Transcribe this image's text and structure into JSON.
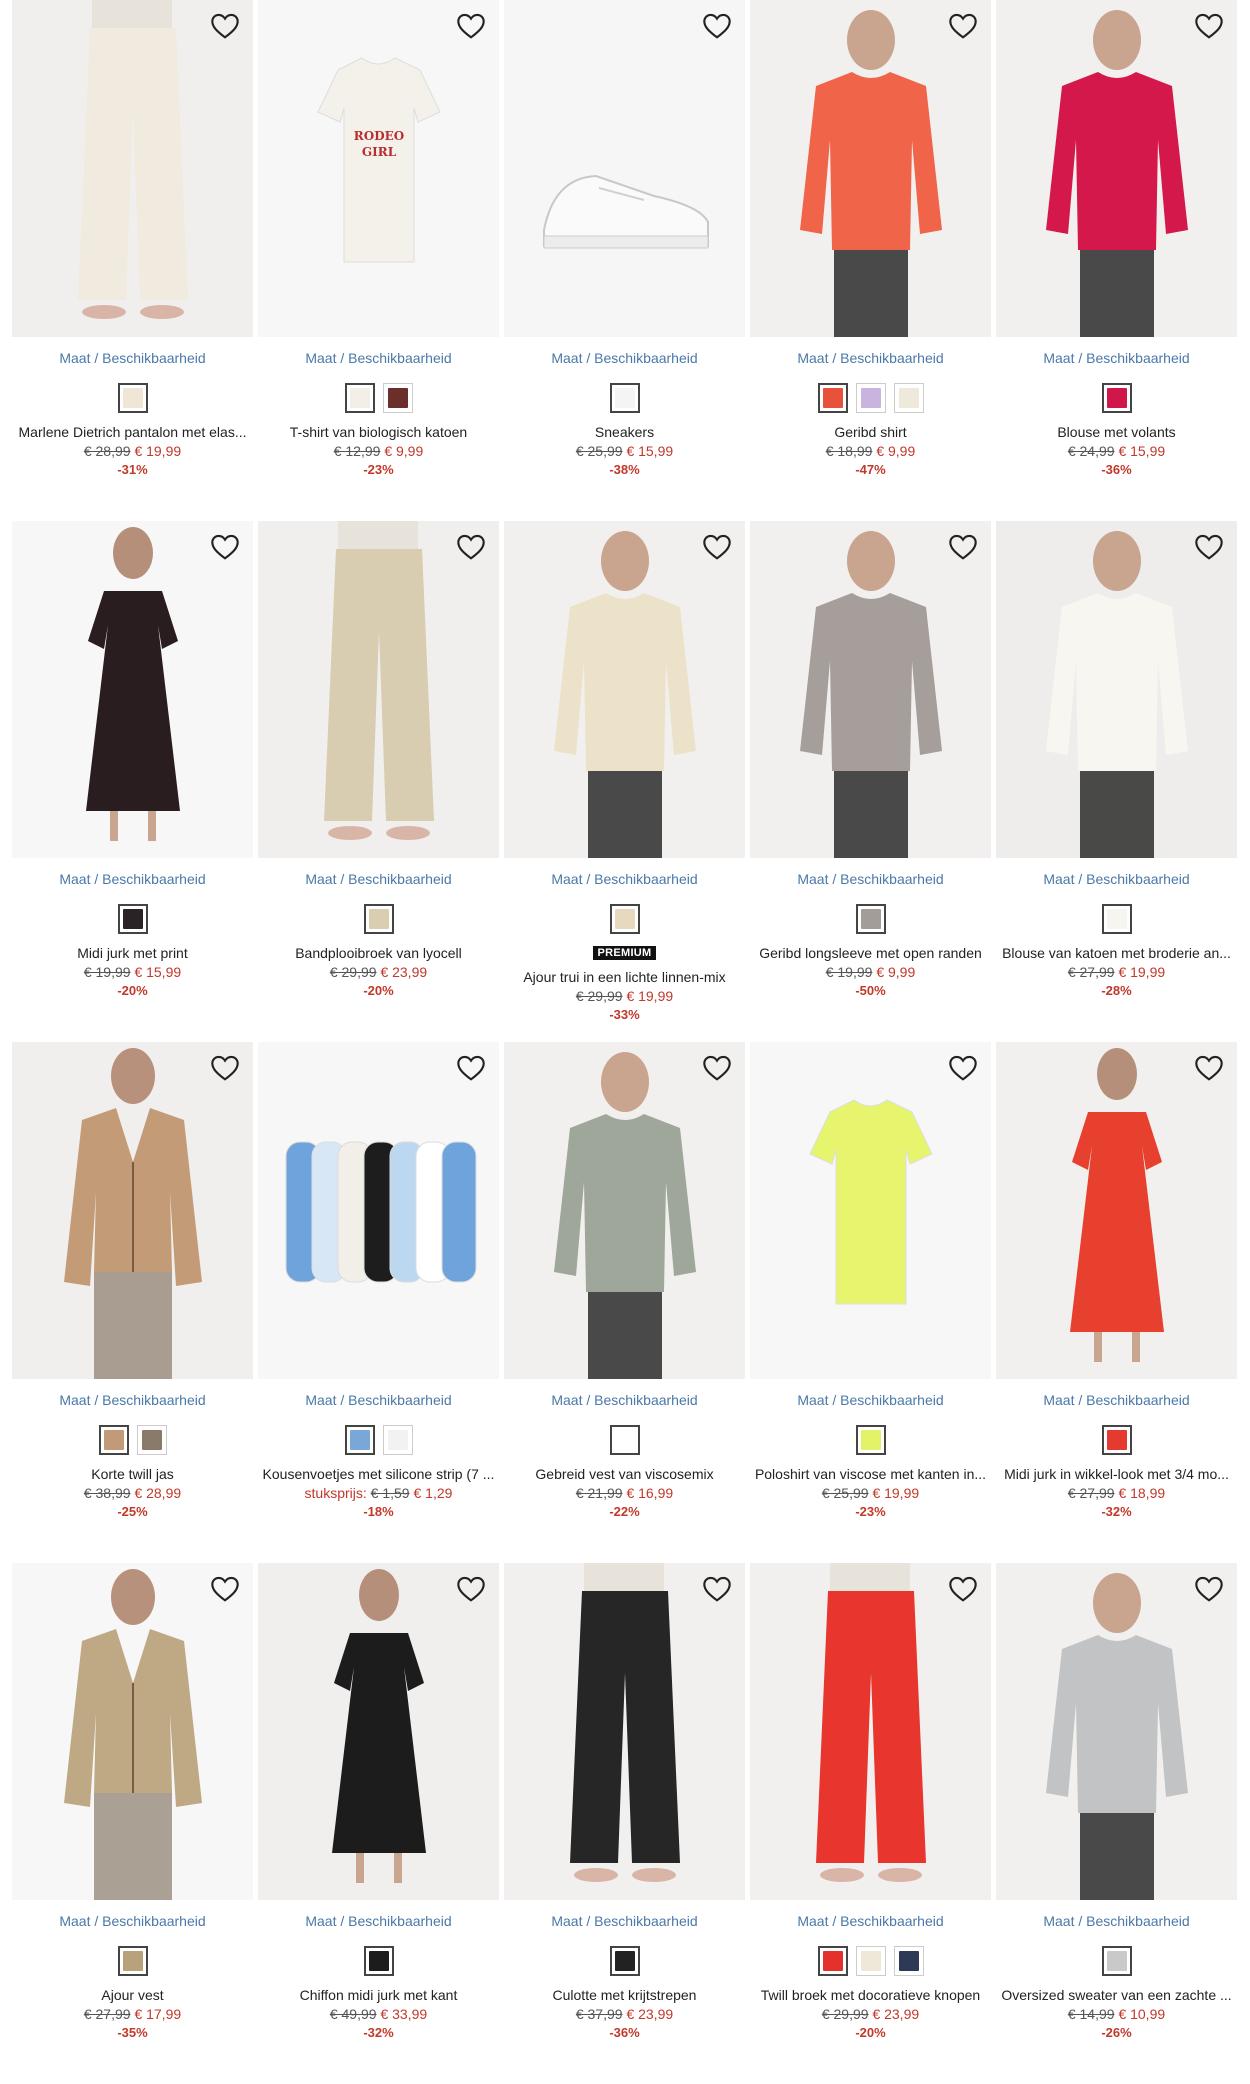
{
  "products": [
    {
      "name": "Marlene Dietrich pantalon met elas...",
      "size_link": "Maat / Beschikbaarheid",
      "old_price": "€ 28,99",
      "new_price": "€ 19,99",
      "discount": "-31%",
      "badge": null,
      "unit_label": null,
      "swatches": [
        "#efe6d6"
      ],
      "figure": {
        "type": "pants",
        "color": "#f1ebdf",
        "bg": "#f0efed"
      }
    },
    {
      "name": "T-shirt van biologisch katoen",
      "size_link": "Maat / Beschikbaarheid",
      "old_price": "€ 12,99",
      "new_price": "€ 9,99",
      "discount": "-23%",
      "badge": null,
      "unit_label": null,
      "swatches": [
        "#f3efe6",
        "#6b2e2a"
      ],
      "figure": {
        "type": "tshirt",
        "color": "#f4f1ea",
        "bg": "#f7f7f7",
        "text": "RODEO GIRL"
      }
    },
    {
      "name": "Sneakers",
      "size_link": "Maat / Beschikbaarheid",
      "old_price": "€ 25,99",
      "new_price": "€ 15,99",
      "discount": "-38%",
      "badge": null,
      "unit_label": null,
      "swatches": [
        "#f4f4f4"
      ],
      "figure": {
        "type": "shoe",
        "color": "#fafafa",
        "bg": "#f6f6f6"
      }
    },
    {
      "name": "Geribd shirt",
      "size_link": "Maat / Beschikbaarheid",
      "old_price": "€ 18,99",
      "new_price": "€ 9,99",
      "discount": "-47%",
      "badge": null,
      "unit_label": null,
      "swatches": [
        "#e8523a",
        "#c9b4e0",
        "#efe9dc"
      ],
      "figure": {
        "type": "top",
        "color": "#f0644a",
        "bg": "#f1f0ee"
      }
    },
    {
      "name": "Blouse met volants",
      "size_link": "Maat / Beschikbaarheid",
      "old_price": "€ 24,99",
      "new_price": "€ 15,99",
      "discount": "-36%",
      "badge": null,
      "unit_label": null,
      "swatches": [
        "#d0174a"
      ],
      "figure": {
        "type": "top",
        "color": "#d4184c",
        "bg": "#f1f0ee"
      }
    },
    {
      "name": "Midi jurk met print",
      "size_link": "Maat / Beschikbaarheid",
      "old_price": "€ 19,99",
      "new_price": "€ 15,99",
      "discount": "-20%",
      "badge": null,
      "unit_label": null,
      "swatches": [
        "#2a2224"
      ],
      "figure": {
        "type": "dress",
        "color": "#2a1d1f",
        "bg": "#f7f7f7"
      }
    },
    {
      "name": "Bandplooibroek van lyocell",
      "size_link": "Maat / Beschikbaarheid",
      "old_price": "€ 29,99",
      "new_price": "€ 23,99",
      "discount": "-20%",
      "badge": null,
      "unit_label": null,
      "swatches": [
        "#d9ceb0"
      ],
      "figure": {
        "type": "pants",
        "color": "#d8cdb0",
        "bg": "#f0efed"
      }
    },
    {
      "name": "Ajour trui in een lichte linnen-mix",
      "size_link": "Maat / Beschikbaarheid",
      "old_price": "€ 29,99",
      "new_price": "€ 19,99",
      "discount": "-33%",
      "badge": "PREMIUM",
      "unit_label": null,
      "swatches": [
        "#e6d9bd"
      ],
      "figure": {
        "type": "top",
        "color": "#ece2c9",
        "bg": "#f1f0ee"
      }
    },
    {
      "name": "Geribd longsleeve met open randen",
      "size_link": "Maat / Beschikbaarheid",
      "old_price": "€ 19,99",
      "new_price": "€ 9,99",
      "discount": "-50%",
      "badge": null,
      "unit_label": null,
      "swatches": [
        "#a39d99"
      ],
      "figure": {
        "type": "top",
        "color": "#a59e9b",
        "bg": "#f1f0ee"
      }
    },
    {
      "name": "Blouse van katoen met broderie an...",
      "size_link": "Maat / Beschikbaarheid",
      "old_price": "€ 27,99",
      "new_price": "€ 19,99",
      "discount": "-28%",
      "badge": null,
      "unit_label": null,
      "swatches": [
        "#f7f5f0"
      ],
      "figure": {
        "type": "top",
        "color": "#f8f6f1",
        "bg": "#eeedeb"
      }
    },
    {
      "name": "Korte twill jas",
      "size_link": "Maat / Beschikbaarheid",
      "old_price": "€ 38,99",
      "new_price": "€ 28,99",
      "discount": "-25%",
      "badge": null,
      "unit_label": null,
      "swatches": [
        "#c39a77",
        "#8a7a6a"
      ],
      "figure": {
        "type": "jacket",
        "color": "#c49b77",
        "bg": "#f0efed"
      }
    },
    {
      "name": "Kousenvoetjes met silicone strip (7 ...",
      "size_link": "Maat / Beschikbaarheid",
      "old_price": "€ 1,59",
      "new_price": "€ 1,29",
      "discount": "-18%",
      "badge": null,
      "unit_label": "stuksprijs:",
      "swatches": [
        "#7aa7d9",
        "#f2f2f2"
      ],
      "figure": {
        "type": "socks",
        "color": "#6fa3dc",
        "bg": "#f7f7f7"
      }
    },
    {
      "name": "Gebreid vest van viscosemix",
      "size_link": "Maat / Beschikbaarheid",
      "old_price": "€ 21,99",
      "new_price": "€ 16,99",
      "discount": "-22%",
      "badge": null,
      "unit_label": null,
      "swatches": [
        "#ffffff"
      ],
      "figure": {
        "type": "top",
        "color": "#9ea79a",
        "bg": "#f1f0ee"
      }
    },
    {
      "name": "Poloshirt van viscose met kanten in...",
      "size_link": "Maat / Beschikbaarheid",
      "old_price": "€ 25,99",
      "new_price": "€ 19,99",
      "discount": "-23%",
      "badge": null,
      "unit_label": null,
      "swatches": [
        "#e4f26a"
      ],
      "figure": {
        "type": "tshirt",
        "color": "#e6f56d",
        "bg": "#f7f7f7",
        "text": ""
      }
    },
    {
      "name": "Midi jurk in wikkel-look met 3/4 mo...",
      "size_link": "Maat / Beschikbaarheid",
      "old_price": "€ 27,99",
      "new_price": "€ 18,99",
      "discount": "-32%",
      "badge": null,
      "unit_label": null,
      "swatches": [
        "#e53a30"
      ],
      "figure": {
        "type": "dress",
        "color": "#e8402f",
        "bg": "#f1f0ee"
      }
    },
    {
      "name": "Ajour vest",
      "size_link": "Maat / Beschikbaarheid",
      "old_price": "€ 27,99",
      "new_price": "€ 17,99",
      "discount": "-35%",
      "badge": null,
      "unit_label": null,
      "swatches": [
        "#b8a27c"
      ],
      "figure": {
        "type": "jacket",
        "color": "#bfa985",
        "bg": "#f7f7f7"
      }
    },
    {
      "name": "Chiffon midi jurk met kant",
      "size_link": "Maat / Beschikbaarheid",
      "old_price": "€ 49,99",
      "new_price": "€ 33,99",
      "discount": "-32%",
      "badge": null,
      "unit_label": null,
      "swatches": [
        "#1c1c1c"
      ],
      "figure": {
        "type": "dress",
        "color": "#1c1c1c",
        "bg": "#f0efed"
      }
    },
    {
      "name": "Culotte met krijtstrepen",
      "size_link": "Maat / Beschikbaarheid",
      "old_price": "€ 37,99",
      "new_price": "€ 23,99",
      "discount": "-36%",
      "badge": null,
      "unit_label": null,
      "swatches": [
        "#222222"
      ],
      "figure": {
        "type": "pants",
        "color": "#262626",
        "bg": "#f1f0ee"
      }
    },
    {
      "name": "Twill broek met docoratieve knopen",
      "size_link": "Maat / Beschikbaarheid",
      "old_price": "€ 29,99",
      "new_price": "€ 23,99",
      "discount": "-20%",
      "badge": null,
      "unit_label": null,
      "swatches": [
        "#e4312c",
        "#efe8d8",
        "#2d3a55"
      ],
      "figure": {
        "type": "pants",
        "color": "#e8352e",
        "bg": "#f1f0ee"
      }
    },
    {
      "name": "Oversized sweater van een zachte ...",
      "size_link": "Maat / Beschikbaarheid",
      "old_price": "€ 14,99",
      "new_price": "€ 10,99",
      "discount": "-26%",
      "badge": null,
      "unit_label": null,
      "swatches": [
        "#c9c9c9"
      ],
      "figure": {
        "type": "top",
        "color": "#c2c3c5",
        "bg": "#f1f0ee"
      }
    }
  ]
}
